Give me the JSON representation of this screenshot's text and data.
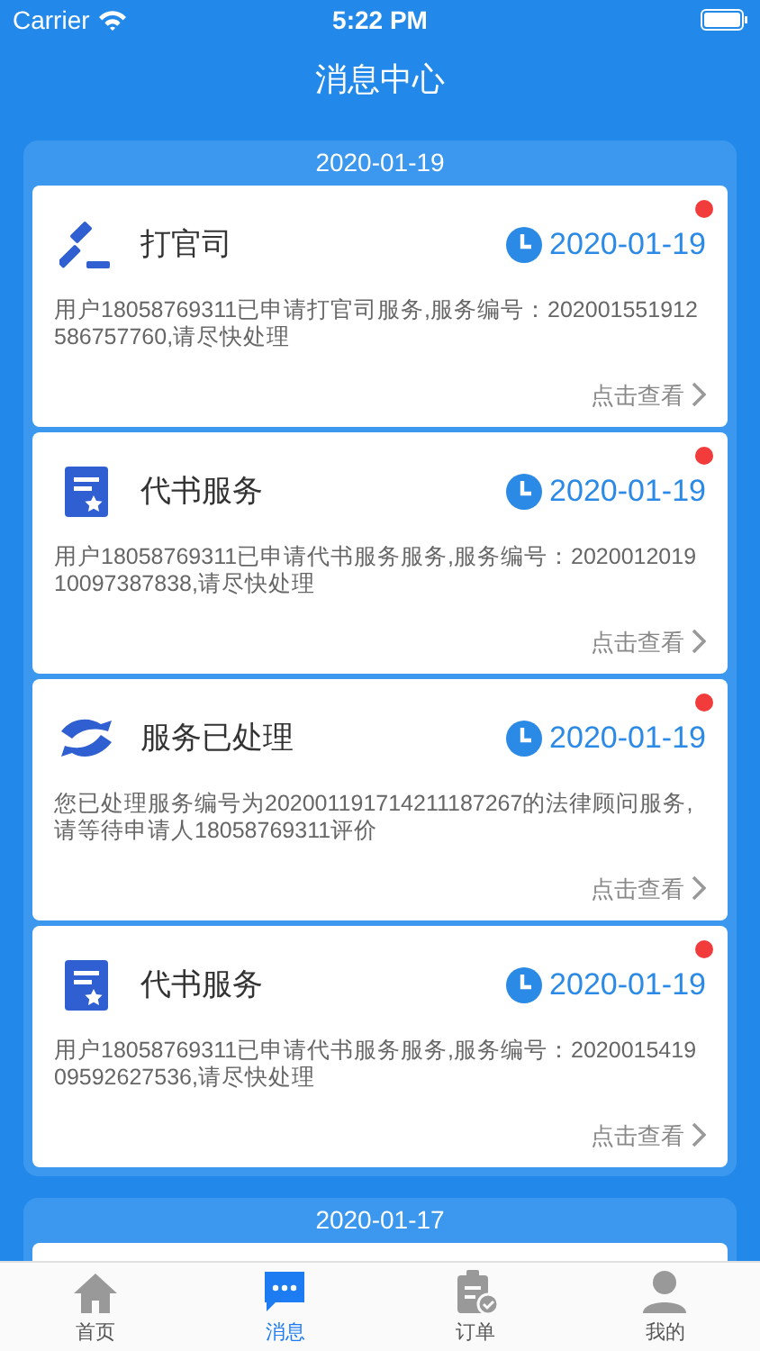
{
  "status_bar": {
    "carrier": "Carrier",
    "time": "5:22 PM"
  },
  "title": "消息中心",
  "groups": [
    {
      "date": "2020-01-19",
      "messages": [
        {
          "kind": "gavel",
          "title": "打官司",
          "date": "2020-01-19",
          "body": "用户18058769311已申请打官司服务,服务编号：202001551912586757760,请尽快处理",
          "unread": true,
          "action": "点击查看"
        },
        {
          "kind": "document",
          "title": "代书服务",
          "date": "2020-01-19",
          "body": "用户18058769311已申请代书服务服务,服务编号：202001201910097387838,请尽快处理",
          "unread": true,
          "action": "点击查看"
        },
        {
          "kind": "hands",
          "title": "服务已处理",
          "date": "2020-01-19",
          "body": "您已处理服务编号为202001191714211187267的法律顾问服务,请等待申请人18058769311评价",
          "unread": true,
          "action": "点击查看"
        },
        {
          "kind": "document",
          "title": "代书服务",
          "date": "2020-01-19",
          "body": "用户18058769311已申请代书服务服务,服务编号：202001541909592627536,请尽快处理",
          "unread": true,
          "action": "点击查看"
        }
      ]
    },
    {
      "date": "2020-01-17"
    }
  ],
  "tabs": [
    {
      "kind": "home",
      "label": "首页",
      "selected": false
    },
    {
      "kind": "message",
      "label": "消息",
      "selected": true
    },
    {
      "kind": "order",
      "label": "订单",
      "selected": false
    },
    {
      "kind": "profile",
      "label": "我的",
      "selected": false
    }
  ]
}
